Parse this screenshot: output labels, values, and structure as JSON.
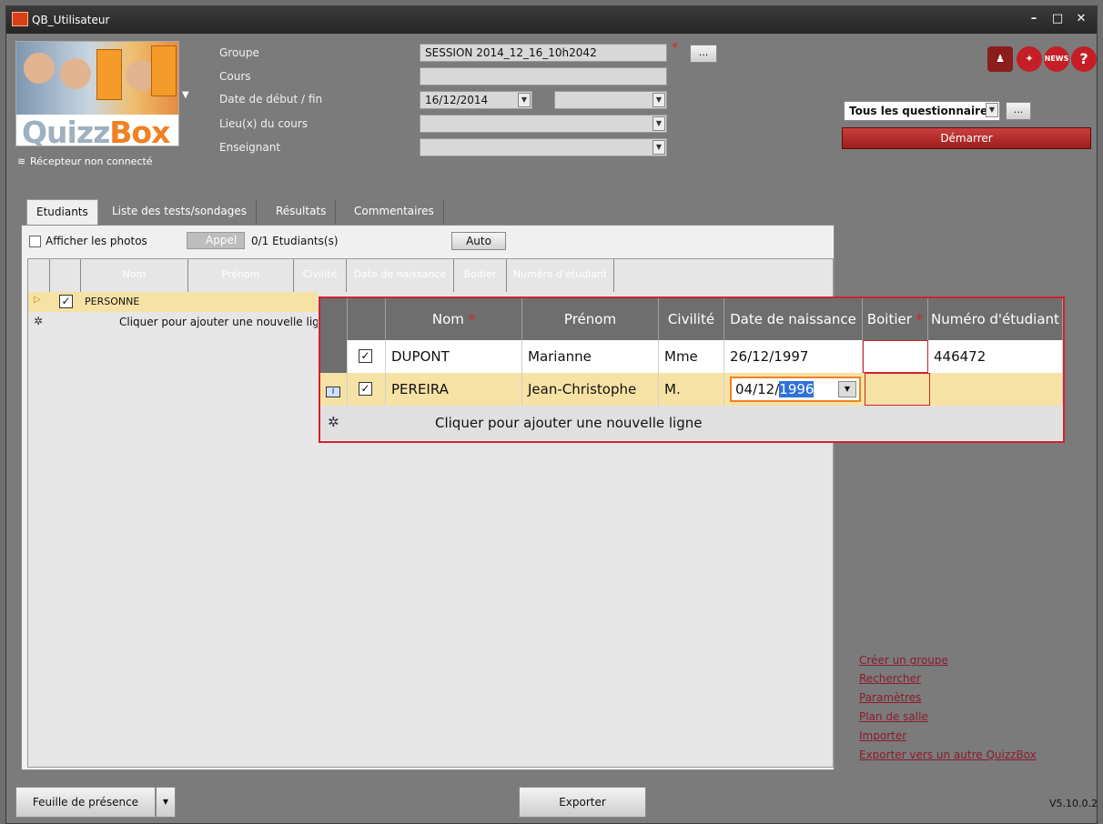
{
  "window": {
    "title": "QB_Utilisateur",
    "controls": [
      "–",
      "□",
      "✕"
    ]
  },
  "logo": {
    "brand_a": "Quizz",
    "brand_b": "Box"
  },
  "receiver_status": "Récepteur non connecté",
  "form": {
    "groupe_label": "Groupe",
    "groupe_value": "SESSION 2014_12_16_10h2042",
    "cours_label": "Cours",
    "cours_value": "",
    "date_label": "Date de début / fin",
    "date_start": "16/12/2014",
    "date_end": "",
    "lieu_label": "Lieu(x) du cours",
    "lieu_value": "",
    "enseignant_label": "Enseignant",
    "enseignant_value": "",
    "ellipsis": "..."
  },
  "top_icons": [
    "person-icon",
    "tips-icon",
    "news-icon",
    "help-icon"
  ],
  "questionnaire": {
    "value": "Tous les questionnaires",
    "start_label": "Démarrer"
  },
  "tabs": [
    "Etudiants",
    "Liste des tests/sondages",
    "Résultats",
    "Commentaires"
  ],
  "toolbar": {
    "show_photos": "Afficher les photos",
    "appel": "Appel",
    "count": "0/1 Etudiants(s)",
    "auto": "Auto"
  },
  "small_grid": {
    "columns": [
      "Nom",
      "Prénom",
      "Civilité",
      "Date de naissance",
      "Boitier",
      "Numéro d'étudiant"
    ],
    "row": {
      "nom": "PERSONNE"
    },
    "add_row": "Cliquer pour ajouter une nouvelle ligne"
  },
  "big_grid": {
    "columns": [
      "Nom",
      "Prénom",
      "Civilité",
      "Date de naissance",
      "Boitier",
      "Numéro d'étudiant"
    ],
    "rows": [
      {
        "nom": "DUPONT",
        "prenom": "Marianne",
        "civilite": "Mme",
        "date": "26/12/1997",
        "boitier": "",
        "numero": "446472"
      },
      {
        "nom": "PEREIRA",
        "prenom": "Jean-Christophe",
        "civilite": "M.",
        "date_prefix": "04/12/",
        "date_selected": "1996",
        "boitier": "",
        "numero": ""
      }
    ],
    "add_row": "Cliquer pour ajouter une nouvelle ligne"
  },
  "links": [
    "Créer un groupe",
    "Rechercher",
    "Paramètres",
    "Plan de salle",
    "Importer",
    "Exporter vers un autre QuizzBox"
  ],
  "bottom": {
    "attendance": "Feuille de présence",
    "export": "Exporter",
    "version": "V5.10.0.2"
  },
  "colors": {
    "accent_red": "#d4202c",
    "highlight_row": "#f7e2a5",
    "selection_blue": "#2f73d8",
    "link": "#8a1b2e"
  }
}
